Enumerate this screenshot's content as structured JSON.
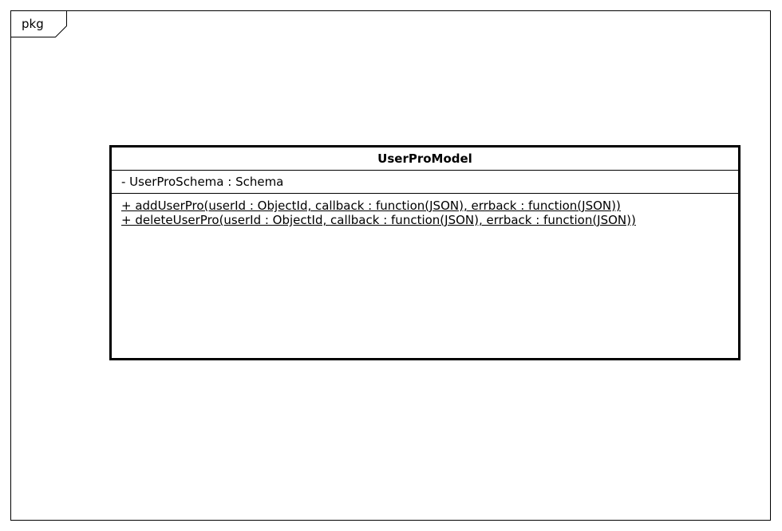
{
  "frame": {
    "label": "pkg"
  },
  "class": {
    "name": "UserProModel",
    "attributes": [
      "- UserProSchema : Schema"
    ],
    "operations": [
      "+ addUserPro(userId : ObjectId, callback : function(JSON), errback : function(JSON))",
      "+ deleteUserPro(userId : ObjectId, callback : function(JSON), errback : function(JSON))"
    ]
  }
}
